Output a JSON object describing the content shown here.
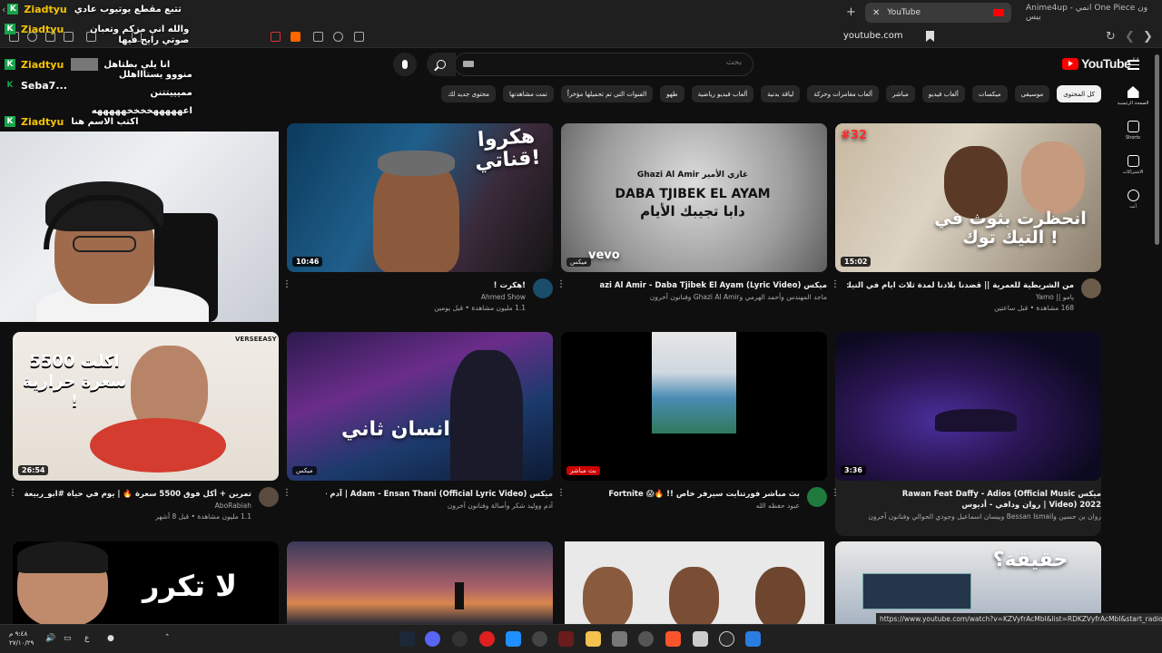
{
  "browser": {
    "tabs": [
      {
        "label": "YouTube",
        "active": true
      },
      {
        "label": "Anime4up - انمي One Piece ون بيس",
        "active": false
      }
    ],
    "url": "youtube.com",
    "status_url": "https://www.youtube.com/watch?v=KZVyfrAcMbI&list=RDKZVyfrAcMbI&start_radio=1"
  },
  "youtube": {
    "logo_text": "YouTube",
    "country": "SA",
    "search_placeholder": "بحث",
    "chips": [
      "كل المحتوى",
      "موسيقى",
      "ميكسات",
      "ألعاب فيديو",
      "مباشر",
      "ألعاب مغامرات وحركة",
      "لياقة بدنية",
      "ألعاب فيديو رياضية",
      "طهو",
      "الفنوات التي تم تحميلها مؤخراً",
      "تمت مشاهدتها",
      "محتوى جديد لك"
    ],
    "guide": [
      {
        "label": "الصفحة الرئيسية",
        "icon": "home-icon"
      },
      {
        "label": "Shorts",
        "icon": "shorts-icon"
      },
      {
        "label": "الاشتراكات",
        "icon": "subscriptions-icon"
      },
      {
        "label": "أنت",
        "icon": "you-icon"
      }
    ]
  },
  "videos": [
    {
      "title": "من الشريطية للعمرية || قضدنا بلادنا لمدة ثلاث ايام في التيك توك 💔 !!",
      "channel": "يامو || Yamo",
      "stats": "168 مشاهدة • قبل ساعتين",
      "duration": "15:02",
      "thumb_text": "انحظرت بثوث في التيك توك !",
      "badge": "#32"
    },
    {
      "title": "ميكس Ghazi Al Amir - Daba Tjibek El Ayam (Lyric Video)",
      "channel": "ماجد المهندس وأحمد الهرمي وGhazi Al Amir وفنانون آخرون",
      "stats": "",
      "duration": "",
      "thumb_text": "DABA TJIBEK EL AYAM",
      "thumb_sub": "Ghazi Al Amir غازي الأمير",
      "thumb_ar": "دابا تجيبك الأيام",
      "tag": "ميكس",
      "vevo": "vevo"
    },
    {
      "title": "!هكرت !",
      "channel": "Ahmed Show",
      "stats": "1.1 مليون مشاهدة • قبل يومين",
      "duration": "10:46",
      "thumb_text": "هكروا قناتي!"
    },
    {
      "title": "",
      "channel": "",
      "stats": "",
      "duration": "",
      "thumb_text": ""
    },
    {
      "title": "ميكس Rawan Feat Daffy - Adios (Official Music Video) 2022 | روان ودافي - أديوس",
      "channel": "روان بن حسين وBessan Ismail وبيسان اسماعيل وجودي الحوالي وفنانون آخرون",
      "stats": "",
      "duration": "3:36",
      "thumb_text": ""
    },
    {
      "title": "بث مباشر فورتنايت سيرفر خاص !! 🔥😱 Fortnite",
      "channel": "عبود حفظه الله",
      "stats": "",
      "duration": "",
      "thumb_text": "",
      "tag": "بث مباشر"
    },
    {
      "title": "ميكس Adam - Ensan Thani (Official Lyric Video) | آدم - انسان ثاني",
      "channel": "آدم ووليد شكر وأصالة وفنانون آخرون",
      "stats": "",
      "duration": "",
      "thumb_text": "انسان ثاني",
      "tag": "ميكس"
    },
    {
      "title": "تمرين + أكل فوق 5500 سعرة 🔥 | يوم في حياة #ابو_ربيعة",
      "channel": "AboRabiah",
      "stats": "1.1 مليون مشاهدة • قبل 8 أشهر",
      "duration": "26:54",
      "thumb_text": "اكلت 5500 سعرة حرارية !",
      "brand": "VERSEEASY"
    },
    {
      "title": "",
      "channel": "",
      "stats": "",
      "duration": "",
      "thumb_text": "حقيقة؟"
    },
    {
      "title": "",
      "channel": "",
      "stats": "",
      "duration": "",
      "thumb_text": ""
    },
    {
      "title": "",
      "channel": "",
      "stats": "",
      "duration": "",
      "thumb_text": ""
    },
    {
      "title": "",
      "channel": "",
      "stats": "",
      "duration": "",
      "thumb_text": "لا تكرر"
    }
  ],
  "chat": [
    {
      "user": "Ziadtyu",
      "msg": "تتبع مقطع يوتيوب عادي"
    },
    {
      "user": "Ziadtyu",
      "msg": "والله اني مزكم وتعبان صوتي رايح فيها"
    },
    {
      "user": "Ziadtyu",
      "msg": "انا يلي بطتاهل"
    },
    {
      "user": "Seba7...",
      "msg": "منووو يستاااهلل مميييتتنن اعهههههخخخخهههههه"
    },
    {
      "user": "Ziadtyu",
      "msg": "اكتب الاسم هنا"
    }
  ],
  "taskbar": {
    "time": "٩:٤٨ م",
    "date": "٢٧/١٠/٢٩",
    "lang": "ع"
  }
}
